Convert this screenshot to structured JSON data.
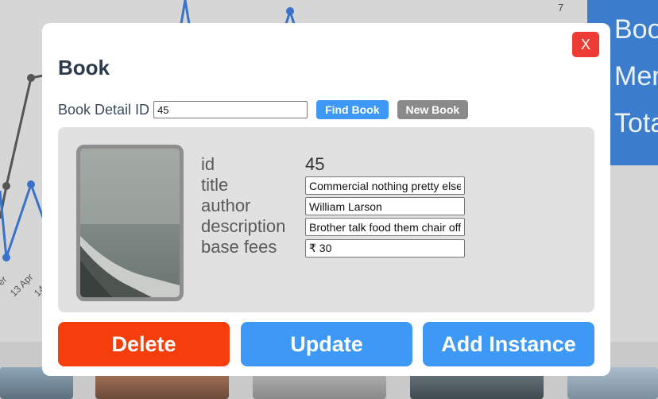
{
  "background": {
    "corner_number": "7",
    "axis_labels": [
      "er",
      "13 Apr",
      "14"
    ],
    "stats": [
      "Boo",
      "Mer",
      "Tota"
    ]
  },
  "modal": {
    "title": "Book",
    "close_label": "X",
    "search": {
      "label": "Book Detail ID",
      "value": "45",
      "find_label": "Find Book",
      "new_label": "New Book"
    },
    "details": {
      "labels": {
        "id": "id",
        "title": "title",
        "author": "author",
        "description": "description",
        "base_fees": "base fees"
      },
      "id_value": "45",
      "title_value": "Commercial nothing pretty else",
      "author_value": "William Larson",
      "description_value": "Brother talk food them chair off",
      "base_fees_value": "₹ 30"
    },
    "actions": {
      "delete_label": "Delete",
      "update_label": "Update",
      "add_instance_label": "Add Instance"
    }
  },
  "colors": {
    "delete": "#f63d0c",
    "primary": "#3d99f5",
    "close": "#ef3b36",
    "secondary": "#8a8a8a"
  }
}
